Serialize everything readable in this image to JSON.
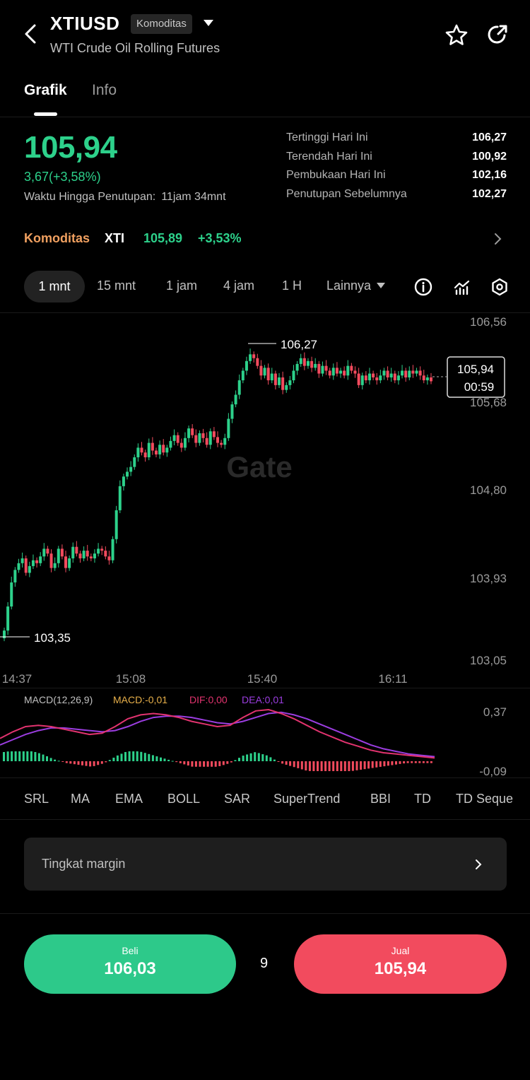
{
  "header": {
    "symbol": "XTIUSD",
    "badge": "Komoditas",
    "subtitle": "WTI Crude Oil Rolling Futures",
    "icons": [
      "back-arrow-icon",
      "chevron-down-icon",
      "star-icon",
      "share-icon"
    ]
  },
  "tabs": [
    {
      "label": "Grafik",
      "active": true
    },
    {
      "label": "Info",
      "active": false
    }
  ],
  "quote": {
    "price": "105,94",
    "change": "3,67(+3,58%)",
    "close_label": "Waktu Hingga Penutupan:",
    "close_value": "11jam 34mnt",
    "stats": [
      {
        "label": "Tertinggi Hari Ini",
        "value": "106,27"
      },
      {
        "label": "Terendah Hari Ini",
        "value": "100,92"
      },
      {
        "label": "Pembukaan Hari Ini",
        "value": "102,16"
      },
      {
        "label": "Penutupan Sebelumnya",
        "value": "102,27"
      }
    ]
  },
  "reference": {
    "category": "Komoditas",
    "symbol": "XTI",
    "price": "105,89",
    "change": "+3,53%"
  },
  "timeframes": {
    "active": "1 mnt",
    "items": [
      "15 mnt",
      "1 jam",
      "4 jam",
      "1 H"
    ],
    "more": "Lainnya",
    "tool_icons": [
      "info-icon",
      "indicator-icon",
      "settings-icon"
    ]
  },
  "chart_data": [
    {
      "type": "candlestick",
      "y_ticks": [
        "106,56",
        "105,68",
        "104,80",
        "103,93",
        "103,05"
      ],
      "x_ticks": [
        "14:37",
        "15:08",
        "15:40",
        "16:11"
      ],
      "ylim": [
        103.05,
        106.56
      ],
      "high_label": "106,27",
      "low_label": "103,35",
      "current_price": "105,94",
      "countdown": "00:59",
      "watermark": "Gate",
      "closes": [
        103.35,
        103.6,
        103.85,
        103.98,
        104.05,
        104.1,
        103.95,
        104.02,
        104.08,
        104.05,
        104.12,
        104.2,
        104.15,
        104.0,
        104.05,
        104.2,
        104.12,
        104.0,
        104.1,
        104.22,
        104.15,
        104.1,
        104.18,
        104.12,
        104.1,
        104.15,
        104.2,
        104.18,
        104.12,
        104.08,
        104.3,
        104.6,
        104.85,
        104.95,
        105.0,
        105.05,
        105.15,
        105.25,
        105.2,
        105.15,
        105.3,
        105.22,
        105.18,
        105.28,
        105.2,
        105.25,
        105.32,
        105.38,
        105.3,
        105.25,
        105.35,
        105.45,
        105.38,
        105.3,
        105.4,
        105.35,
        105.28,
        105.42,
        105.36,
        105.3,
        105.28,
        105.35,
        105.55,
        105.7,
        105.8,
        105.95,
        106.05,
        106.15,
        106.22,
        106.18,
        106.1,
        106.0,
        106.08,
        105.95,
        106.02,
        105.9,
        105.98,
        105.85,
        105.9,
        105.95,
        106.05,
        106.12,
        106.18,
        106.1,
        106.15,
        106.08,
        106.12,
        106.02,
        106.1,
        106.05,
        106.0,
        106.08,
        106.02,
        106.05,
        106.0,
        106.1,
        106.05,
        106.02,
        105.9,
        106.0,
        105.95,
        106.02,
        105.98,
        105.95,
        106.0,
        106.05,
        105.98,
        106.02,
        105.95,
        106.0,
        106.05,
        105.98,
        106.05,
        106.02,
        106.05,
        106.0,
        105.95,
        105.98,
        105.94
      ]
    },
    {
      "type": "macd",
      "title": "MACD(12,26,9)",
      "macd_label": "MACD:-0,01",
      "dif_label": "DIF:0,00",
      "dea_label": "DEA:0,01",
      "y_ticks": [
        "0,37",
        "-0,09"
      ],
      "ylim": [
        -0.09,
        0.37
      ],
      "dif": [
        0.15,
        0.2,
        0.24,
        0.25,
        0.24,
        0.22,
        0.2,
        0.18,
        0.19,
        0.24,
        0.3,
        0.33,
        0.34,
        0.33,
        0.31,
        0.28,
        0.26,
        0.24,
        0.25,
        0.31,
        0.36,
        0.37,
        0.34,
        0.3,
        0.25,
        0.2,
        0.16,
        0.12,
        0.09,
        0.06,
        0.04,
        0.03,
        0.02,
        0.01,
        0.0
      ],
      "dea": [
        0.1,
        0.14,
        0.18,
        0.21,
        0.23,
        0.23,
        0.22,
        0.21,
        0.2,
        0.21,
        0.24,
        0.28,
        0.31,
        0.32,
        0.32,
        0.31,
        0.29,
        0.27,
        0.26,
        0.28,
        0.31,
        0.34,
        0.35,
        0.33,
        0.3,
        0.26,
        0.22,
        0.18,
        0.14,
        0.1,
        0.07,
        0.05,
        0.03,
        0.02,
        0.01
      ]
    }
  ],
  "indicators": [
    "SRL",
    "MA",
    "EMA",
    "BOLL",
    "SAR",
    "SuperTrend",
    "BBI",
    "TD",
    "TD Seque"
  ],
  "margin": {
    "label": "Tingkat margin"
  },
  "actions": {
    "buy_label": "Beli",
    "buy_price": "106,03",
    "spread": "9",
    "sell_label": "Jual",
    "sell_price": "105,94"
  },
  "colors": {
    "up": "#2dd18b",
    "down": "#f24b5e",
    "accent": "#f0a060",
    "macd": "#e8b04a",
    "dif": "#e2336f",
    "dea": "#9b3de0"
  }
}
